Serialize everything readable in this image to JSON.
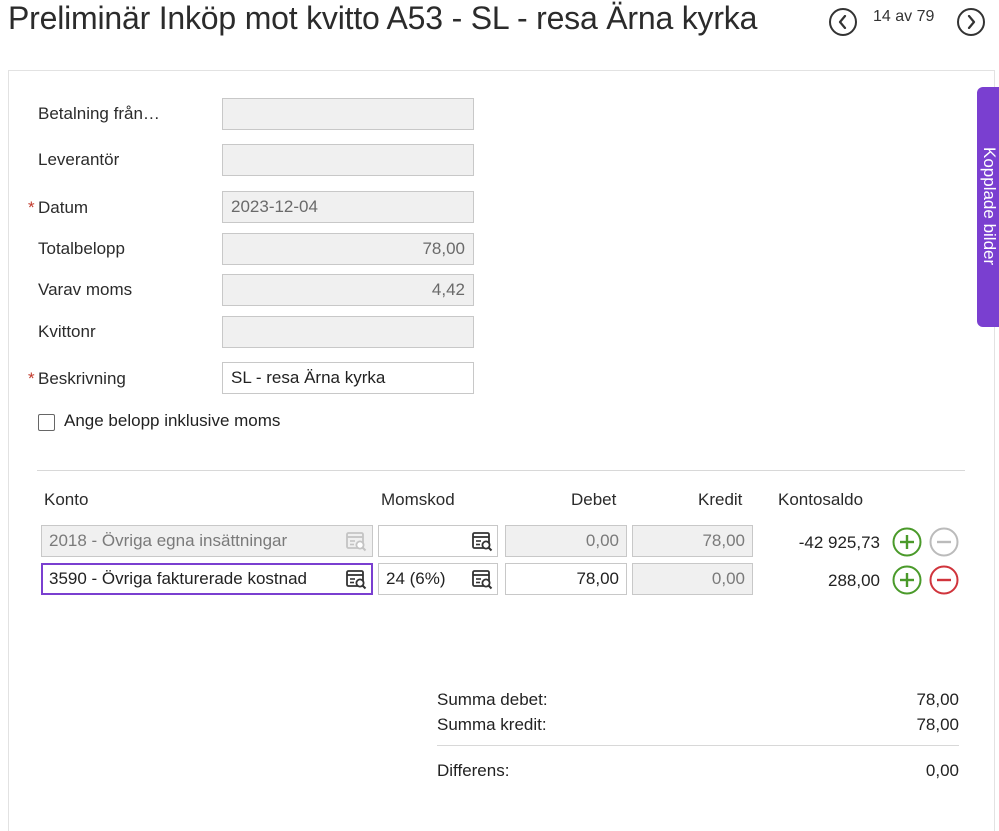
{
  "header": {
    "title": "Preliminär Inköp mot kvitto A53  -  SL - resa Ärna kyrka",
    "pager_text": "14 av 79"
  },
  "side_tab": {
    "label": "Kopplade bilder"
  },
  "form": {
    "betalning": {
      "label": "Betalning från…",
      "value": ""
    },
    "leverantor": {
      "label": "Leverantör",
      "value": ""
    },
    "datum": {
      "label": "Datum",
      "value": "2023-12-04",
      "required_mark": "*"
    },
    "totalbelopp": {
      "label": "Totalbelopp",
      "value": "78,00"
    },
    "varav_moms": {
      "label": "Varav moms",
      "value": "4,42"
    },
    "kvittonr": {
      "label": "Kvittonr",
      "value": ""
    },
    "beskrivning": {
      "label": "Beskrivning",
      "value": "SL - resa Ärna kyrka",
      "required_mark": "*"
    },
    "inkl_moms": {
      "label": "Ange belopp inklusive moms",
      "checked": false
    }
  },
  "table": {
    "headers": {
      "konto": "Konto",
      "momskod": "Momskod",
      "debet": "Debet",
      "kredit": "Kredit",
      "kontosaldo": "Kontosaldo"
    },
    "rows": [
      {
        "konto": "2018 - Övriga egna insättningar",
        "momskod": "",
        "debet": "0,00",
        "kredit": "78,00",
        "saldo": "-42 925,73"
      },
      {
        "konto": "3590 - Övriga fakturerade kostnad",
        "momskod": "24 (6%)",
        "debet": "78,00",
        "kredit": "0,00",
        "saldo": "288,00"
      }
    ]
  },
  "summary": {
    "debet_label": "Summa debet:",
    "debet_value": "78,00",
    "kredit_label": "Summa kredit:",
    "kredit_value": "78,00",
    "diff_label": "Differens:",
    "diff_value": "0,00"
  },
  "colors": {
    "accent": "#7a3fd0",
    "add": "#4a9a2a",
    "remove": "#d0343c",
    "disabled": "#bbbbbb"
  }
}
